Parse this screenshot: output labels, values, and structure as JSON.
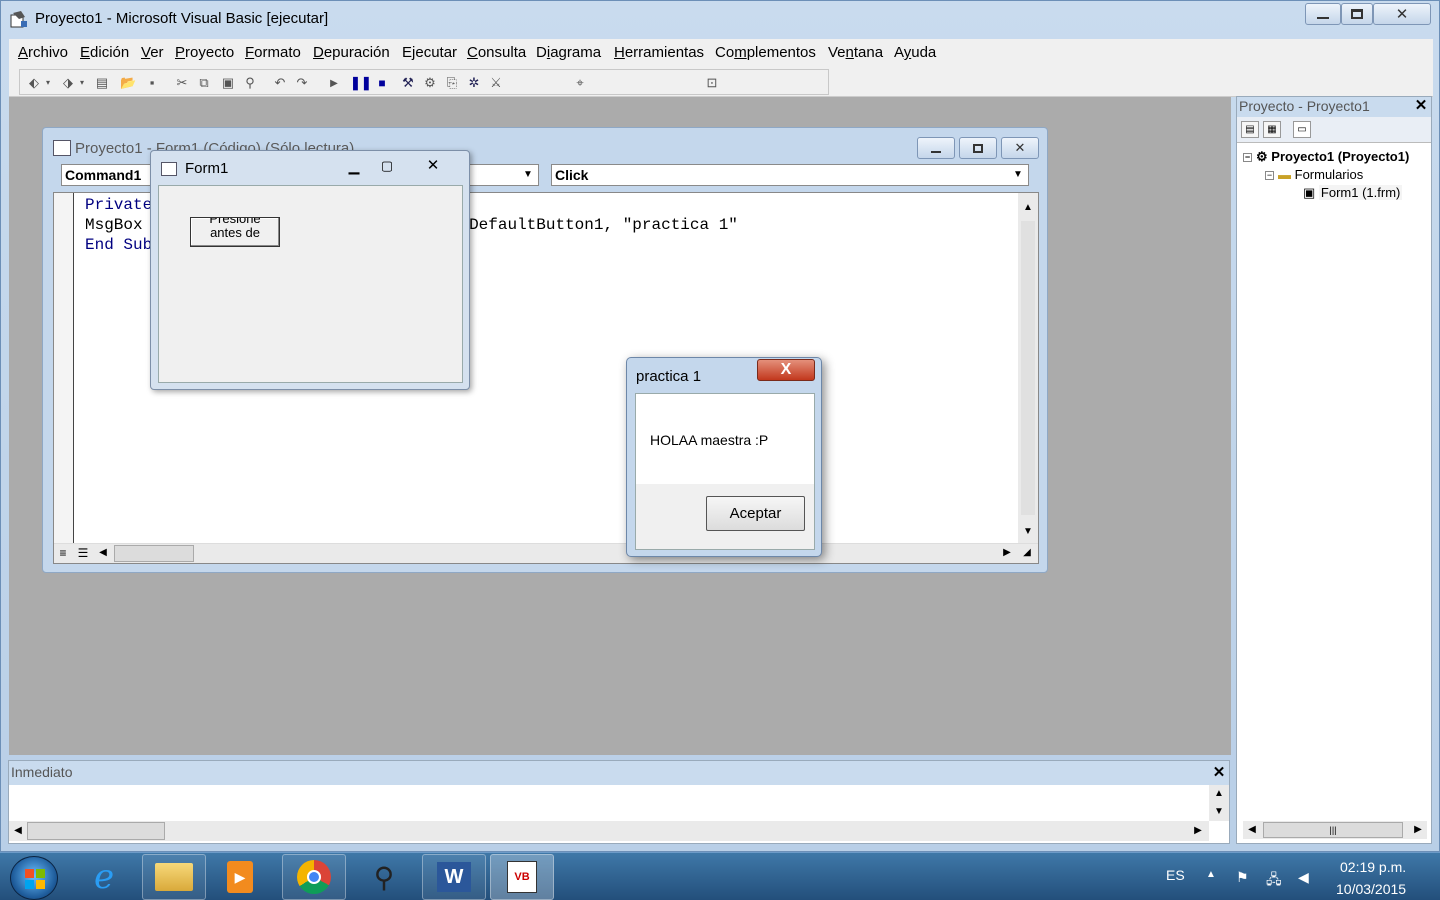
{
  "window": {
    "title": "Proyecto1 - Microsoft Visual Basic [ejecutar]"
  },
  "menu": {
    "items": [
      {
        "label": "Archivo",
        "underline": "A"
      },
      {
        "label": "Edición",
        "underline": "E"
      },
      {
        "label": "Ver",
        "underline": "V"
      },
      {
        "label": "Proyecto",
        "underline": "P"
      },
      {
        "label": "Formato",
        "underline": "F"
      },
      {
        "label": "Depuración",
        "underline": "D"
      },
      {
        "label": "Ejecutar",
        "underline": "j"
      },
      {
        "label": "Consulta",
        "underline": "C"
      },
      {
        "label": "Diagrama",
        "underline": "i"
      },
      {
        "label": "Herramientas",
        "underline": "H"
      },
      {
        "label": "Complementos",
        "underline": "m"
      },
      {
        "label": "Ventana",
        "underline": "n"
      },
      {
        "label": "Ayuda",
        "underline": "y"
      }
    ]
  },
  "code_window": {
    "title": "Proyecto1 - Form1 (Código) (Sólo lectura)",
    "object_combo": "Command1",
    "procedure_combo": "Click",
    "lines": [
      {
        "text": "Private Sub Command1_Click()",
        "keyword": true
      },
      {
        "text": "MsgBox \"HOLAA maestra :P\", vbOKOnly + vbDefaultButton1, \"practica 1\"",
        "keyword": false
      },
      {
        "text": "End Sub",
        "keyword": true
      }
    ]
  },
  "form1": {
    "title": "Form1",
    "button_label_top": "Presione",
    "button_label": "antes de"
  },
  "msgbox": {
    "title": "practica 1",
    "message": "HOLAA maestra :P",
    "ok_button": "Aceptar",
    "close_glyph": "X"
  },
  "project_explorer": {
    "title": "Proyecto - Proyecto1",
    "tree": {
      "project": "Proyecto1 (Proyecto1)",
      "folder": "Formularios",
      "form": "Form1 (1.frm)"
    }
  },
  "immediate": {
    "title": "Inmediato"
  },
  "taskbar": {
    "apps": [
      "internet-explorer",
      "file-explorer",
      "media-player",
      "chrome",
      "tennis-app",
      "word",
      "vb6"
    ],
    "language": "ES",
    "time": "02:19 p.m.",
    "date": "10/03/2015"
  }
}
